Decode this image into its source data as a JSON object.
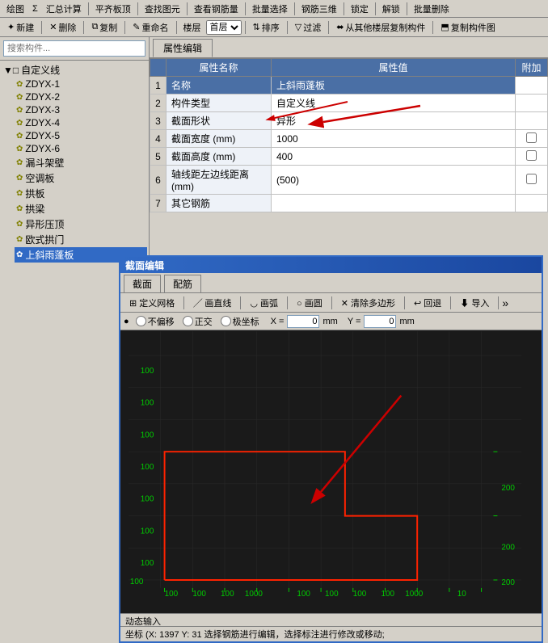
{
  "app": {
    "title": "截面编辑"
  },
  "toolbar1": {
    "items": [
      "绘图",
      "Σ",
      "汇总计算",
      "平齐板顶",
      "查找图元",
      "查看钢筋量",
      "批量选择",
      "钢筋三维",
      "锁定",
      "解锁",
      "批量删除"
    ]
  },
  "toolbar2": {
    "new": "新建",
    "delete": "删除",
    "copy": "复制",
    "rename": "重命名",
    "layer": "楼层",
    "floor": "首层",
    "sort": "排序",
    "filter": "过滤",
    "copy_from": "从其他楼层复制构件",
    "copy_comp": "复制构件图"
  },
  "search": {
    "placeholder": "搜索构件..."
  },
  "tree": {
    "root": "自定义线",
    "items": [
      {
        "id": "ZDYX-1",
        "label": "ZDYX-1"
      },
      {
        "id": "ZDYX-2",
        "label": "ZDYX-2"
      },
      {
        "id": "ZDYX-3",
        "label": "ZDYX-3"
      },
      {
        "id": "ZDYX-4",
        "label": "ZDYX-4"
      },
      {
        "id": "ZDYX-5",
        "label": "ZDYX-5"
      },
      {
        "id": "ZDYX-6",
        "label": "ZDYX-6"
      },
      {
        "id": "漏斗架壁",
        "label": "漏斗架壁"
      },
      {
        "id": "空调板",
        "label": "空调板"
      },
      {
        "id": "拱板",
        "label": "拱板"
      },
      {
        "id": "拱梁",
        "label": "拱梁"
      },
      {
        "id": "异形压顶",
        "label": "异形压顶"
      },
      {
        "id": "欧式拱门",
        "label": "欧式拱门"
      },
      {
        "id": "上斜雨蓬板",
        "label": "上斜雨蓬板"
      }
    ]
  },
  "property_panel": {
    "tab": "属性编辑",
    "headers": [
      "属性名称",
      "属性值",
      "附加"
    ],
    "rows": [
      {
        "num": "1",
        "name": "名称",
        "value": "上斜雨蓬板",
        "extra": "",
        "highlighted": true
      },
      {
        "num": "2",
        "name": "构件类型",
        "value": "自定义线",
        "extra": ""
      },
      {
        "num": "3",
        "name": "截面形状",
        "value": "异形",
        "extra": ""
      },
      {
        "num": "4",
        "name": "截面宽度 (mm)",
        "value": "1000",
        "extra": "checkbox"
      },
      {
        "num": "5",
        "name": "截面高度 (mm)",
        "value": "400",
        "extra": "checkbox"
      },
      {
        "num": "6",
        "name": "轴线距左边线距离 (mm)",
        "value": "(500)",
        "extra": "checkbox"
      },
      {
        "num": "7",
        "name": "其它钢筋",
        "value": "",
        "extra": ""
      }
    ]
  },
  "dialog": {
    "title": "截面编辑",
    "tabs": [
      "截面",
      "配筋"
    ],
    "toolbar": {
      "define_grid": "定义网格",
      "draw_line": "画直线",
      "draw_arc": "画弧",
      "draw_rect": "画圆",
      "clear_poly": "清除多边形",
      "undo": "回退",
      "import": "导入"
    },
    "coords": {
      "modes": [
        "不偏移",
        "正交",
        "极坐标"
      ],
      "x_label": "X =",
      "y_label": "Y =",
      "x_value": "0",
      "y_value": "0",
      "unit": "mm"
    }
  },
  "status": {
    "dynamic_input": "动态输入",
    "coords_text": "坐标 (X: 1397 Y: 31  选择钢筋进行编辑，选择标注进行修改或移动;"
  },
  "canvas": {
    "grid_labels_y": [
      "100",
      "100",
      "100",
      "100",
      "100",
      "100",
      "100",
      "100"
    ],
    "grid_labels_x": [
      "100",
      "100",
      "100",
      "100",
      "100",
      "100",
      "100",
      "100",
      "100",
      "100"
    ],
    "dimension_right": [
      "200",
      "200",
      "200"
    ],
    "dimension_bottom": "100 100 100 1000 100 100 100 100 1000",
    "shape_color": "#ff0000"
  }
}
